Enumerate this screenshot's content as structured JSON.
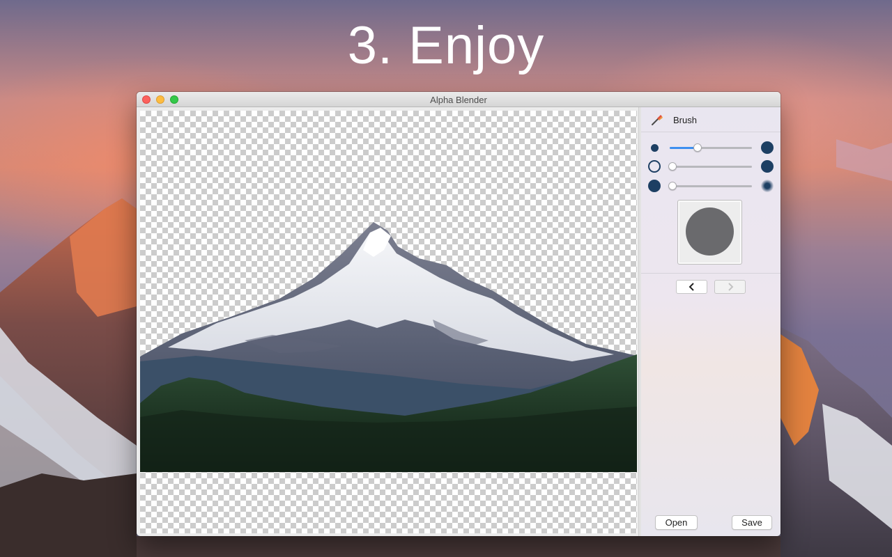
{
  "headline": "3. Enjoy",
  "window": {
    "title": "Alpha Blender"
  },
  "sidebar": {
    "tool_label": "Brush",
    "tool_icon": "brush-icon",
    "sliders": [
      {
        "name": "size",
        "value": 0.34
      },
      {
        "name": "opacity",
        "value": 0.0
      },
      {
        "name": "softness",
        "value": 0.0
      }
    ],
    "nav": {
      "back_icon": "chevron-left-icon",
      "forward_icon": "chevron-right-icon"
    },
    "open_label": "Open",
    "save_label": "Save"
  },
  "colors": {
    "brush_dot": "#1d3f63",
    "slider_fill": "#3d8ff0",
    "preview_brush": "#6a6a6d"
  }
}
